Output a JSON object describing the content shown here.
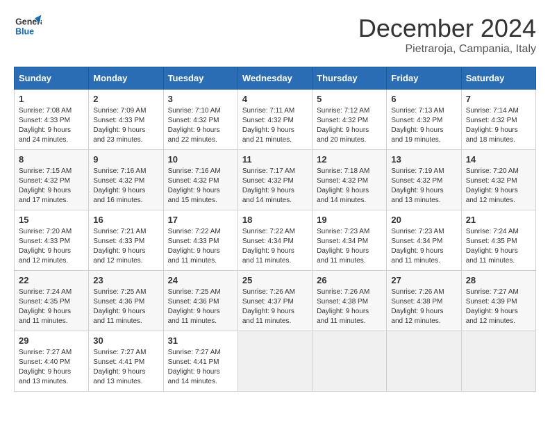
{
  "header": {
    "logo_line1": "General",
    "logo_line2": "Blue",
    "title": "December 2024",
    "location": "Pietraroja, Campania, Italy"
  },
  "days_of_week": [
    "Sunday",
    "Monday",
    "Tuesday",
    "Wednesday",
    "Thursday",
    "Friday",
    "Saturday"
  ],
  "weeks": [
    [
      {
        "day": "1",
        "sunrise": "7:08 AM",
        "sunset": "4:33 PM",
        "daylight": "9 hours and 24 minutes."
      },
      {
        "day": "2",
        "sunrise": "7:09 AM",
        "sunset": "4:33 PM",
        "daylight": "9 hours and 23 minutes."
      },
      {
        "day": "3",
        "sunrise": "7:10 AM",
        "sunset": "4:32 PM",
        "daylight": "9 hours and 22 minutes."
      },
      {
        "day": "4",
        "sunrise": "7:11 AM",
        "sunset": "4:32 PM",
        "daylight": "9 hours and 21 minutes."
      },
      {
        "day": "5",
        "sunrise": "7:12 AM",
        "sunset": "4:32 PM",
        "daylight": "9 hours and 20 minutes."
      },
      {
        "day": "6",
        "sunrise": "7:13 AM",
        "sunset": "4:32 PM",
        "daylight": "9 hours and 19 minutes."
      },
      {
        "day": "7",
        "sunrise": "7:14 AM",
        "sunset": "4:32 PM",
        "daylight": "9 hours and 18 minutes."
      }
    ],
    [
      {
        "day": "8",
        "sunrise": "7:15 AM",
        "sunset": "4:32 PM",
        "daylight": "9 hours and 17 minutes."
      },
      {
        "day": "9",
        "sunrise": "7:16 AM",
        "sunset": "4:32 PM",
        "daylight": "9 hours and 16 minutes."
      },
      {
        "day": "10",
        "sunrise": "7:16 AM",
        "sunset": "4:32 PM",
        "daylight": "9 hours and 15 minutes."
      },
      {
        "day": "11",
        "sunrise": "7:17 AM",
        "sunset": "4:32 PM",
        "daylight": "9 hours and 14 minutes."
      },
      {
        "day": "12",
        "sunrise": "7:18 AM",
        "sunset": "4:32 PM",
        "daylight": "9 hours and 14 minutes."
      },
      {
        "day": "13",
        "sunrise": "7:19 AM",
        "sunset": "4:32 PM",
        "daylight": "9 hours and 13 minutes."
      },
      {
        "day": "14",
        "sunrise": "7:20 AM",
        "sunset": "4:32 PM",
        "daylight": "9 hours and 12 minutes."
      }
    ],
    [
      {
        "day": "15",
        "sunrise": "7:20 AM",
        "sunset": "4:33 PM",
        "daylight": "9 hours and 12 minutes."
      },
      {
        "day": "16",
        "sunrise": "7:21 AM",
        "sunset": "4:33 PM",
        "daylight": "9 hours and 12 minutes."
      },
      {
        "day": "17",
        "sunrise": "7:22 AM",
        "sunset": "4:33 PM",
        "daylight": "9 hours and 11 minutes."
      },
      {
        "day": "18",
        "sunrise": "7:22 AM",
        "sunset": "4:34 PM",
        "daylight": "9 hours and 11 minutes."
      },
      {
        "day": "19",
        "sunrise": "7:23 AM",
        "sunset": "4:34 PM",
        "daylight": "9 hours and 11 minutes."
      },
      {
        "day": "20",
        "sunrise": "7:23 AM",
        "sunset": "4:34 PM",
        "daylight": "9 hours and 11 minutes."
      },
      {
        "day": "21",
        "sunrise": "7:24 AM",
        "sunset": "4:35 PM",
        "daylight": "9 hours and 11 minutes."
      }
    ],
    [
      {
        "day": "22",
        "sunrise": "7:24 AM",
        "sunset": "4:35 PM",
        "daylight": "9 hours and 11 minutes."
      },
      {
        "day": "23",
        "sunrise": "7:25 AM",
        "sunset": "4:36 PM",
        "daylight": "9 hours and 11 minutes."
      },
      {
        "day": "24",
        "sunrise": "7:25 AM",
        "sunset": "4:36 PM",
        "daylight": "9 hours and 11 minutes."
      },
      {
        "day": "25",
        "sunrise": "7:26 AM",
        "sunset": "4:37 PM",
        "daylight": "9 hours and 11 minutes."
      },
      {
        "day": "26",
        "sunrise": "7:26 AM",
        "sunset": "4:38 PM",
        "daylight": "9 hours and 11 minutes."
      },
      {
        "day": "27",
        "sunrise": "7:26 AM",
        "sunset": "4:38 PM",
        "daylight": "9 hours and 12 minutes."
      },
      {
        "day": "28",
        "sunrise": "7:27 AM",
        "sunset": "4:39 PM",
        "daylight": "9 hours and 12 minutes."
      }
    ],
    [
      {
        "day": "29",
        "sunrise": "7:27 AM",
        "sunset": "4:40 PM",
        "daylight": "9 hours and 13 minutes."
      },
      {
        "day": "30",
        "sunrise": "7:27 AM",
        "sunset": "4:41 PM",
        "daylight": "9 hours and 13 minutes."
      },
      {
        "day": "31",
        "sunrise": "7:27 AM",
        "sunset": "4:41 PM",
        "daylight": "9 hours and 14 minutes."
      },
      null,
      null,
      null,
      null
    ]
  ]
}
